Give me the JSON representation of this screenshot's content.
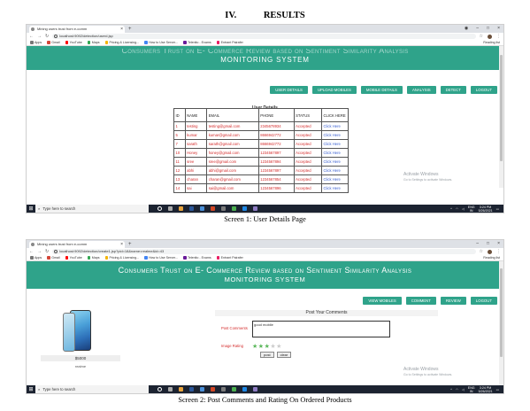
{
  "section": {
    "number": "IV.",
    "title": "RESULTS"
  },
  "screen1": {
    "tab_title": "Mining users trust from e-comm",
    "url": "localhost:9092/detection/userd.jsp",
    "bookmarks": [
      "Apps",
      "Gmail",
      "YouTube",
      "Maps",
      "Pricing & Licensing...",
      "How to Use Server...",
      "Telenito - Exams",
      "Entrant Pairafer"
    ],
    "reading_list": "Reading list",
    "banner_line1": "Consumers Trust on E- Commerce Review based on Sentiment Similarity Analysis",
    "banner_line2": "MONITORING SYSTEM",
    "nav": [
      "USER DETAILS",
      "UPLOAD MOBILES",
      "MOBILE DETAILS",
      "ANALYSIS",
      "DETECT",
      "LOGOUT"
    ],
    "table_title": "User Details",
    "columns": [
      "ID",
      "NAME",
      "EMAIL",
      "PHONE",
      "STATUS",
      "CLICK HERE"
    ],
    "rows": [
      [
        "1",
        "testing",
        "testing@gmail.com",
        "2345678934",
        "Accepted",
        "Click Here"
      ],
      [
        "5",
        "kumar",
        "kumar@gmail.com",
        "8666942772",
        "Accepted",
        "Click Here"
      ],
      [
        "7",
        "sarath",
        "sarath@gmail.com",
        "8666942772",
        "Accepted",
        "Click Here"
      ],
      [
        "10",
        "Honey",
        "honey@gmail.com",
        "1234567897",
        "Accepted",
        "Click Here"
      ],
      [
        "11",
        "sree",
        "sree@gmail.com",
        "1234567894",
        "Accepted",
        "Click Here"
      ],
      [
        "12",
        "abhi",
        "abhi@gmail.com",
        "1234567897",
        "Accepted",
        "Click Here"
      ],
      [
        "13",
        "charan",
        "charan@gmail.com",
        "1234567854",
        "Accepted",
        "Click Here"
      ],
      [
        "14",
        "sai",
        "sai@gmail.com",
        "1234567896",
        "Accepted",
        "Click Here"
      ]
    ],
    "activate_title": "Activate Windows",
    "activate_sub": "Go to Settings to activate Windows.",
    "search_placeholder": "Type here to search",
    "tray_lang": "ENG",
    "tray_region": "IN",
    "tray_time": "3:24 PM",
    "tray_date": "5/26/2021",
    "caption": "Screen 1: User Details Page"
  },
  "screen2": {
    "tab_title": "Mining users trust from e-comm",
    "url": "localhost:9092/detection/create1.jsp?pid=18&name=realme&id=43",
    "bookmarks": [
      "Apps",
      "Gmail",
      "YouTube",
      "Maps",
      "Pricing & Licensing...",
      "How to Use Server...",
      "Telenito - Exams",
      "Entrant Pairafer"
    ],
    "reading_list": "Reading list",
    "banner_line1": "Consumers Trust on E- Commerce Review based on Sentiment Similarity Analysis",
    "banner_line2": "MONITORING SYSTEM",
    "nav": [
      "VIEW MOBILES",
      "COMMENT",
      "REVIEW",
      "LOGOUT"
    ],
    "product_price": "$5000",
    "product_name": "realme",
    "panel_title": "Post Your Comments",
    "comments_label": "Post Comments",
    "comments_value": "good mobile",
    "rating_label": "Image Rating",
    "rating": 3,
    "rating_max": 5,
    "post_button": "post",
    "clear_button": "clear",
    "activate_title": "Activate Windows",
    "activate_sub": "Go to Settings to activate Windows.",
    "search_placeholder": "Type here to search",
    "tray_lang": "ENG",
    "tray_region": "IN",
    "tray_time": "3:24 PM",
    "tray_date": "5/26/2021",
    "caption": "Screen 2: Post Comments and Rating On Ordered Products"
  },
  "colors": {
    "teal": "#2fa38a",
    "red_text": "#d42b2b",
    "link": "#3a5fd0",
    "star": "#5cb85c"
  }
}
